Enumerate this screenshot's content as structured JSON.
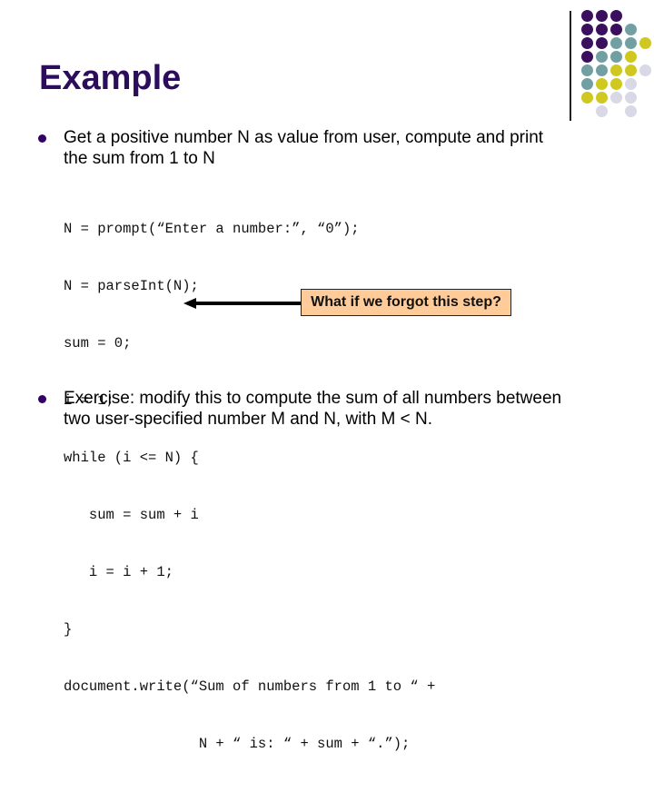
{
  "slide": {
    "title": "Example",
    "colors": {
      "title": "#2b0d5c",
      "bullet": "#330066",
      "callout_fill": "#ffcc99"
    },
    "decoration": {
      "palette": {
        "P": "#3a0f5e",
        "T": "#72a0a2",
        "Y": "#cfc820",
        "L": "#d8d8e6"
      },
      "grid": [
        "PPP  ",
        "PPPT ",
        "PPTTY",
        "PTTY ",
        "TTYYL",
        "TYYL ",
        "YYLL ",
        " L L "
      ]
    },
    "bullets": [
      {
        "icon": "bullet-dot",
        "lines": [
          "Get a positive number N as value from user, compute and print",
          "the sum from 1 to N"
        ]
      },
      {
        "icon": "bullet-dot",
        "lines": [
          "Exercise: modify this to compute the sum of all numbers between",
          "two user-specified number M and N, with M < N."
        ]
      }
    ],
    "code_lines": [
      "N = prompt(“Enter a number:”, “0”);",
      "N = parseInt(N);",
      "sum = 0;",
      "i = 1;",
      "while (i <= N) {",
      "   sum = sum + i",
      "   i = i + 1;",
      "}",
      "document.write(“Sum of numbers from 1 to “ +",
      "                N + “ is: “ + sum + “.”);"
    ],
    "callout": {
      "text": "What if we forgot this step?",
      "arrow_icon": "arrow-left-icon"
    }
  }
}
